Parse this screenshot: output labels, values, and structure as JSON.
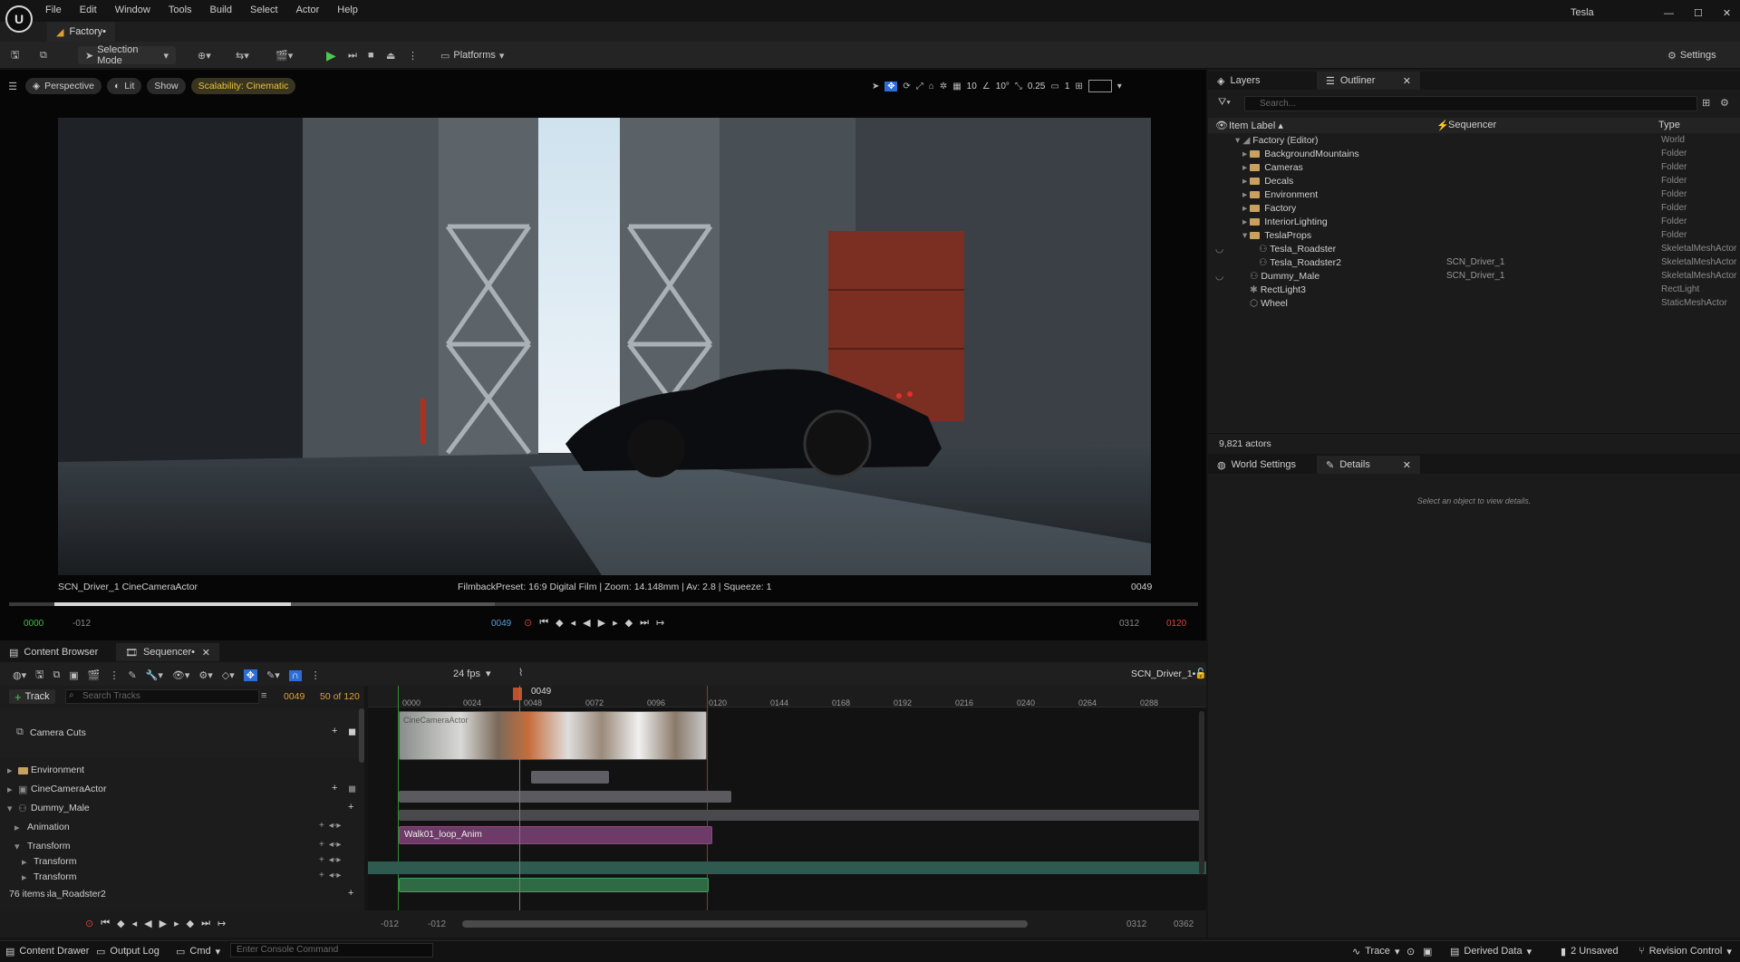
{
  "app": {
    "menus": [
      "File",
      "Edit",
      "Window",
      "Tools",
      "Build",
      "Select",
      "Actor",
      "Help"
    ],
    "user": "Tesla",
    "document_tab": "Factory•"
  },
  "toolbar": {
    "mode": "Selection Mode",
    "platforms": "Platforms",
    "settings": "Settings"
  },
  "viewport": {
    "perspective": "Perspective",
    "lit": "Lit",
    "show": "Show",
    "scalability": "Scalability: Cinematic",
    "grid_value": "10",
    "angle_value": "10°",
    "scale_value": "0.25",
    "camera_speed": "1",
    "camera_label": "SCN_Driver_1  CineCameraActor",
    "film_info": "FilmbackPreset: 16:9 Digital Film | Zoom: 14.148mm | Av: 2.8 | Squeeze: 1",
    "frame": "0049",
    "scrub_progress": 0.408,
    "start_in": "0000",
    "start_out": "-012",
    "current": "0049",
    "end_in": "0312",
    "end_out": "0120"
  },
  "outliner": {
    "tabs": [
      "Layers",
      "Outliner"
    ],
    "search_placeholder": "Search...",
    "columns": [
      "Item Label ▴",
      "Sequencer",
      "Type"
    ],
    "rows": [
      {
        "label": "Factory (Editor)",
        "seq": "",
        "type": "World"
      },
      {
        "label": "BackgroundMountains",
        "seq": "",
        "type": "Folder"
      },
      {
        "label": "Cameras",
        "seq": "",
        "type": "Folder"
      },
      {
        "label": "Decals",
        "seq": "",
        "type": "Folder"
      },
      {
        "label": "Environment",
        "seq": "",
        "type": "Folder"
      },
      {
        "label": "Factory",
        "seq": "",
        "type": "Folder"
      },
      {
        "label": "InteriorLighting",
        "seq": "",
        "type": "Folder"
      },
      {
        "label": "TeslaProps",
        "seq": "",
        "type": "Folder"
      },
      {
        "label": "Tesla_Roadster",
        "seq": "",
        "type": "SkeletalMeshActor"
      },
      {
        "label": "Tesla_Roadster2",
        "seq": "SCN_Driver_1",
        "type": "SkeletalMeshActor"
      },
      {
        "label": "Dummy_Male",
        "seq": "SCN_Driver_1",
        "type": "SkeletalMeshActor"
      },
      {
        "label": "RectLight3",
        "seq": "",
        "type": "RectLight"
      },
      {
        "label": "Wheel",
        "seq": "",
        "type": "StaticMeshActor"
      }
    ],
    "actor_count": "9,821 actors"
  },
  "details": {
    "tabs": [
      "World Settings",
      "Details"
    ],
    "empty_text": "Select an object to view details."
  },
  "bottom": {
    "tabs": [
      "Content Browser",
      "Sequencer•"
    ]
  },
  "sequencer": {
    "fps": "24 fps",
    "sequence_name": "SCN_Driver_1•",
    "track_button": "Track",
    "search_placeholder": "Search Tracks",
    "current_frame": "0049",
    "count": "50 of 120",
    "playhead_label": "0049",
    "ticks": [
      "0000",
      "0024",
      "0048",
      "0072",
      "0096",
      "0120",
      "0144",
      "0168",
      "0192",
      "0216",
      "0240",
      "0264",
      "0288"
    ],
    "tracks": [
      "Camera Cuts",
      "Environment",
      "CineCameraActor",
      "Dummy_Male",
      "Animation",
      "Transform",
      "Transform",
      "Transform",
      "Tesla_Roadster2"
    ],
    "anim_clip": "Walk01_loop_Anim",
    "camera_clip": "CineCameraActor",
    "items_label": "76 items",
    "range_start_out": "-012",
    "range_start_in": "-012",
    "range_end_in": "0312",
    "range_end_out": "0362"
  },
  "statusbar": {
    "content_drawer": "Content Drawer",
    "output_log": "Output Log",
    "cmd": "Cmd",
    "console_placeholder": "Enter Console Command",
    "trace": "Trace",
    "derived_data": "Derived Data",
    "unsaved": "2 Unsaved",
    "revision": "Revision Control"
  }
}
